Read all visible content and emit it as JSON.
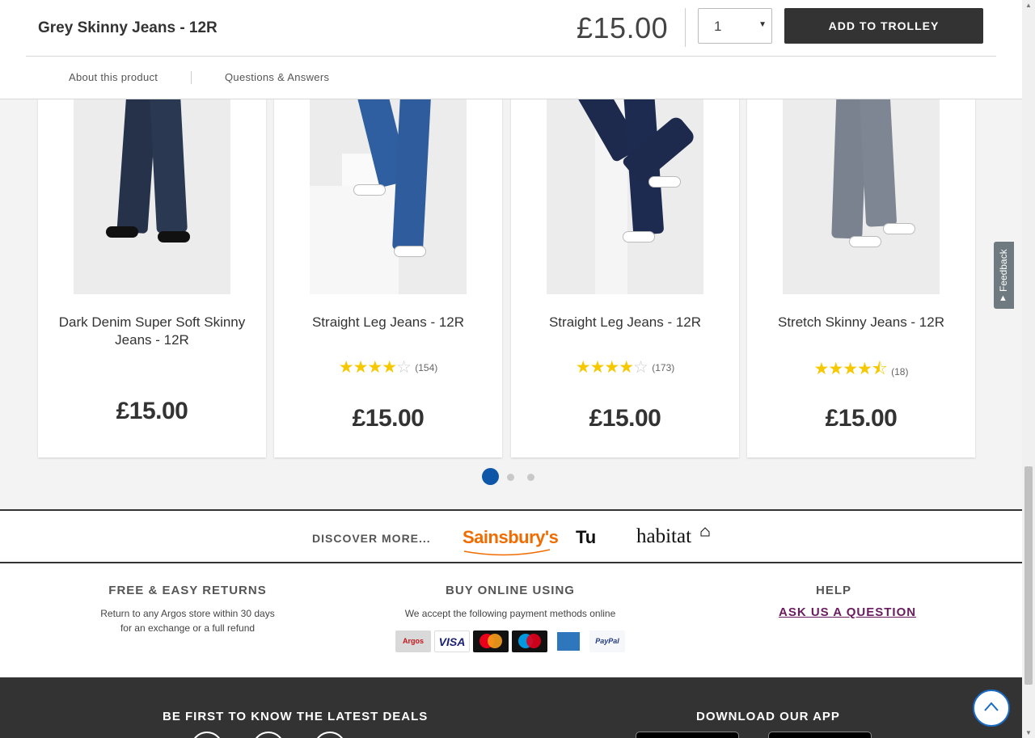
{
  "sticky": {
    "title": "Grey Skinny Jeans - 12R",
    "price": "£15.00",
    "quantity": "1",
    "add_label": "ADD TO TROLLEY",
    "tabs": [
      "About this product",
      "Questions & Answers"
    ]
  },
  "products": [
    {
      "name": "Dark Denim Super Soft Skinny Jeans - 12R",
      "price": "£15.00",
      "rating": null,
      "reviews": ""
    },
    {
      "name": "Straight Leg Jeans - 12R",
      "price": "£15.00",
      "rating": 3.5,
      "reviews": "(154)"
    },
    {
      "name": "Straight Leg Jeans - 12R",
      "price": "£15.00",
      "rating": 4,
      "reviews": "(173)"
    },
    {
      "name": "Stretch Skinny Jeans - 12R",
      "price": "£15.00",
      "rating": 4.5,
      "reviews": "(18)"
    }
  ],
  "carousel": {
    "pages": 3,
    "active": 1
  },
  "discover": {
    "label": "DISCOVER MORE...",
    "brands": [
      "Sainsbury's",
      "Tu",
      "habitat"
    ]
  },
  "info": {
    "returns": {
      "heading": "FREE & EASY RETURNS",
      "line1": "Return to any Argos store within 30 days",
      "line2": "for an exchange or a full refund"
    },
    "pay": {
      "heading": "BUY ONLINE USING",
      "text": "We accept the following payment methods online",
      "methods": [
        "Argos card",
        "VISA",
        "mastercard",
        "maestro",
        "American Express",
        "PayPal"
      ]
    },
    "help": {
      "heading": "HELP",
      "link": "ASK US A QUESTION"
    }
  },
  "footer": {
    "deals": "BE FIRST TO KNOW THE LATEST DEALS",
    "app": "DOWNLOAD OUR APP"
  },
  "feedback": "Feedback",
  "colors": {
    "accent_blue": "#0e57a8",
    "dark": "#333333",
    "help_link": "#6a1b5e",
    "star": "#f5c800"
  }
}
